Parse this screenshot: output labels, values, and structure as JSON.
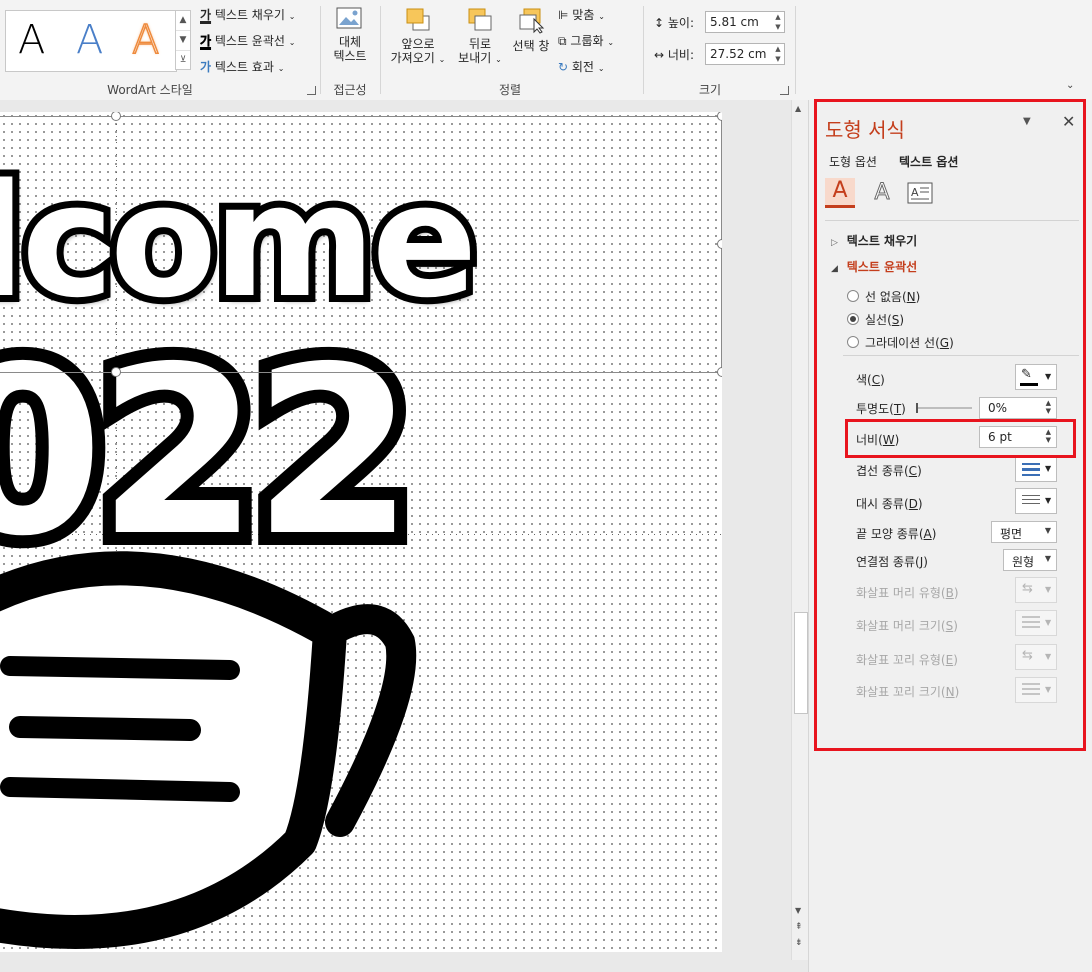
{
  "ribbon": {
    "wordart_gallery": [
      "A",
      "A",
      "A"
    ],
    "text_fill": "텍스트 채우기",
    "text_outline": "텍스트 윤곽선",
    "text_effects": "텍스트 효과",
    "wordart_group": "WordArt 스타일",
    "alt_text_line1": "대체",
    "alt_text_line2": "텍스트",
    "accessibility_group": "접근성",
    "bring_forward_line1": "앞으로",
    "bring_forward_line2": "가져오기",
    "send_backward_line1": "뒤로",
    "send_backward_line2": "보내기",
    "selection_pane": "선택 창",
    "align": "맞춤",
    "group": "그룹화",
    "rotate": "회전",
    "arrange_group": "정렬",
    "height_label": "높이:",
    "height_value": "5.81 cm",
    "width_label": "너비:",
    "width_value": "27.52 cm",
    "size_group": "크기"
  },
  "slide": {
    "line1": "lcome",
    "line2": "022"
  },
  "pane": {
    "title": "도형 서식",
    "tab_shape": "도형 옵션",
    "tab_text": "텍스트 옵션",
    "section_fill": "텍스트 채우기",
    "section_outline": "텍스트 윤곽선",
    "radio_none": "선 없음",
    "radio_none_key": "N",
    "radio_solid": "실선",
    "radio_solid_key": "S",
    "radio_gradient": "그라데이션 선",
    "radio_gradient_key": "G",
    "color_label": "색",
    "color_key": "C",
    "transparency_label": "투명도",
    "transparency_key": "T",
    "transparency_value": "0%",
    "width_label": "너비",
    "width_key": "W",
    "width_value": "6 pt",
    "compound_label": "겹선 종류",
    "compound_key": "C",
    "dash_label": "대시 종류",
    "dash_key": "D",
    "cap_label": "끝 모양 종류",
    "cap_key": "A",
    "cap_value": "평면",
    "join_label": "연결점 종류",
    "join_key": "J",
    "join_value": "원형",
    "begin_arrow_type": "화살표 머리 유형",
    "begin_arrow_type_key": "B",
    "begin_arrow_size": "화살표 머리 크기",
    "begin_arrow_size_key": "S",
    "end_arrow_type": "화살표 꼬리 유형",
    "end_arrow_type_key": "E",
    "end_arrow_size": "화살표 꼬리 크기",
    "end_arrow_size_key": "N"
  },
  "colors": {
    "accent": "#c43e1c",
    "highlight_box": "#e8141e"
  }
}
